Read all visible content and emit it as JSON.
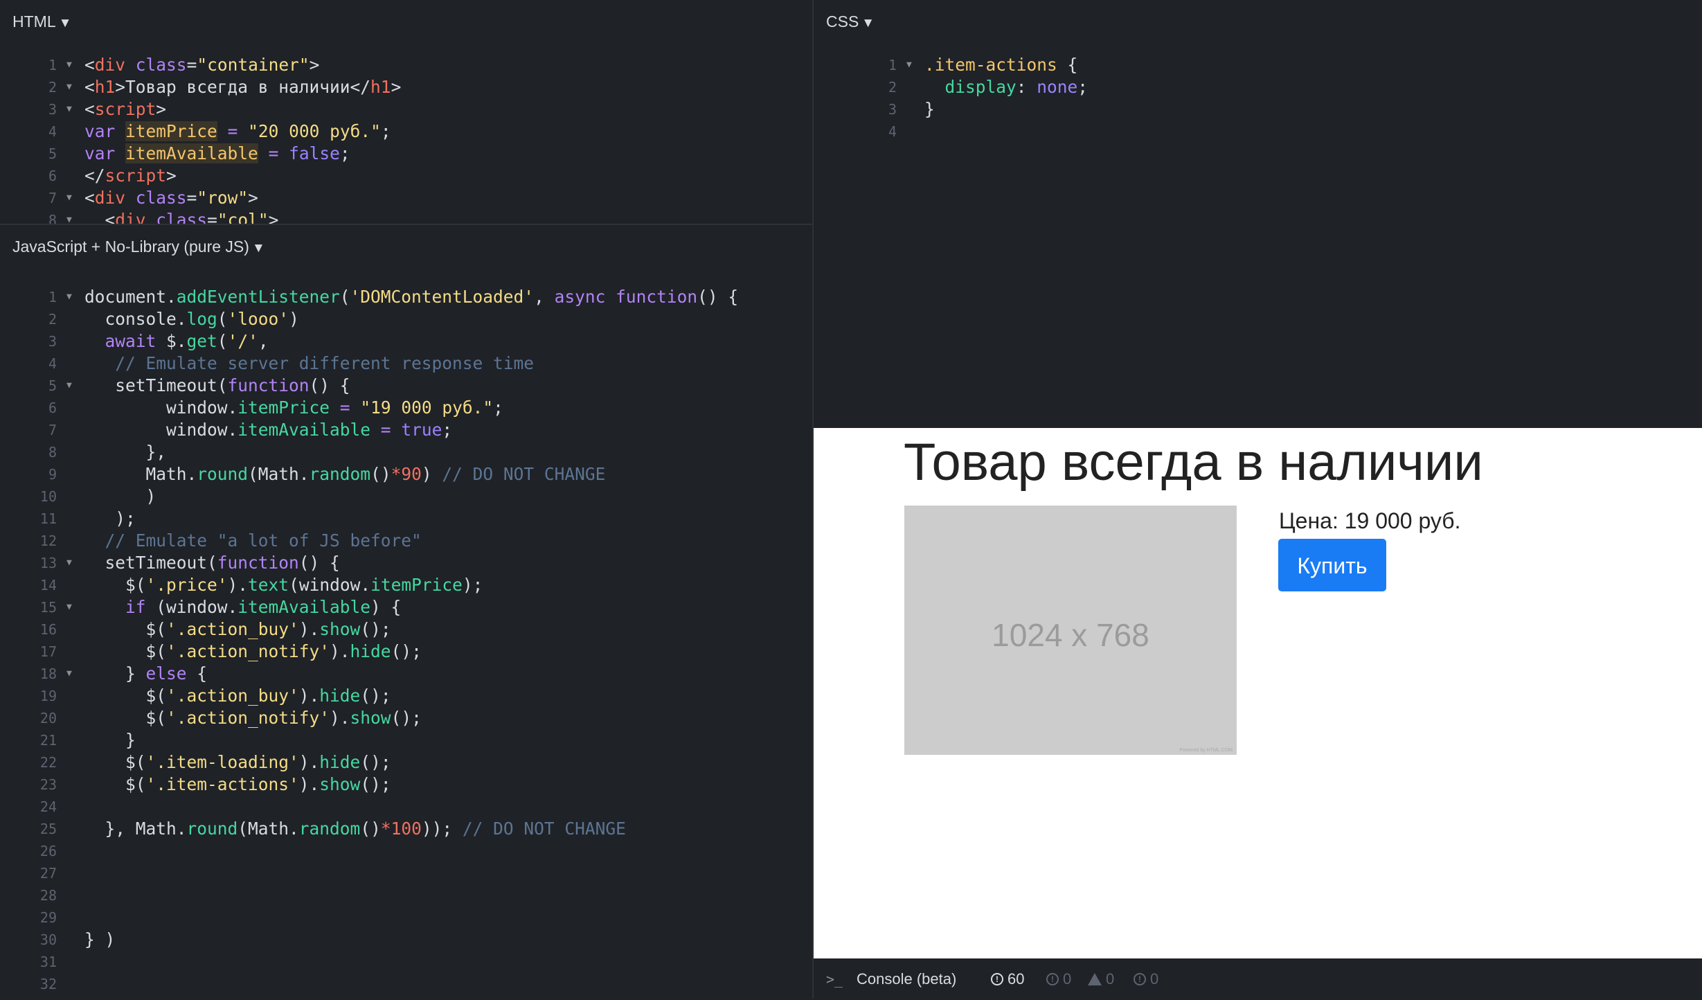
{
  "html_panel": {
    "title": "HTML",
    "lines": [
      {
        "n": "1",
        "f": true,
        "p": [
          [
            "",
            "<"
          ],
          [
            "c-tag",
            "div"
          ],
          [
            "",
            " "
          ],
          [
            "c-kw",
            "class"
          ],
          [
            "",
            "="
          ],
          [
            "c-str",
            "\"container\""
          ],
          [
            "",
            ">"
          ]
        ]
      },
      {
        "n": "2",
        "f": true,
        "p": [
          [
            "",
            "<"
          ],
          [
            "c-tag",
            "h1"
          ],
          [
            "",
            ">Товар всегда в наличии</"
          ],
          [
            "c-tag",
            "h1"
          ],
          [
            "",
            ">"
          ]
        ]
      },
      {
        "n": "3",
        "f": true,
        "p": [
          [
            "",
            "<"
          ],
          [
            "c-tag",
            "script"
          ],
          [
            "",
            ">"
          ]
        ]
      },
      {
        "n": "4",
        "f": false,
        "p": [
          [
            "c-kw",
            "var"
          ],
          [
            "",
            " "
          ],
          [
            "c-var hl",
            "itemPrice"
          ],
          [
            "",
            " "
          ],
          [
            "c-kw",
            "="
          ],
          [
            "",
            " "
          ],
          [
            "c-str",
            "\"20 000 руб.\""
          ],
          [
            "",
            ";"
          ]
        ]
      },
      {
        "n": "5",
        "f": false,
        "p": [
          [
            "c-kw",
            "var"
          ],
          [
            "",
            " "
          ],
          [
            "c-var hl",
            "itemAvailable"
          ],
          [
            "",
            " "
          ],
          [
            "c-kw",
            "="
          ],
          [
            "",
            " "
          ],
          [
            "c-bool",
            "false"
          ],
          [
            "",
            ";"
          ]
        ]
      },
      {
        "n": "6",
        "f": false,
        "p": [
          [
            "",
            "</"
          ],
          [
            "c-tag",
            "script"
          ],
          [
            "",
            ">"
          ]
        ]
      },
      {
        "n": "7",
        "f": true,
        "p": [
          [
            "",
            "<"
          ],
          [
            "c-tag",
            "div"
          ],
          [
            "",
            " "
          ],
          [
            "c-kw",
            "class"
          ],
          [
            "",
            "="
          ],
          [
            "c-str",
            "\"row\""
          ],
          [
            "",
            ">"
          ]
        ]
      },
      {
        "n": "8",
        "f": true,
        "p": [
          [
            "",
            "  <"
          ],
          [
            "c-tag",
            "div"
          ],
          [
            "",
            " "
          ],
          [
            "c-kw",
            "class"
          ],
          [
            "",
            "="
          ],
          [
            "c-str",
            "\"col\""
          ],
          [
            "",
            ">"
          ]
        ]
      }
    ]
  },
  "js_panel": {
    "title": "JavaScript + No-Library (pure JS)",
    "lines": [
      {
        "n": "1",
        "f": true,
        "p": [
          [
            "",
            "document."
          ],
          [
            "c-fn",
            "addEventListener"
          ],
          [
            "",
            "("
          ],
          [
            "c-str",
            "'DOMContentLoaded'"
          ],
          [
            "",
            ", "
          ],
          [
            "c-kw",
            "async function"
          ],
          [
            "",
            "() {"
          ]
        ]
      },
      {
        "n": "2",
        "f": false,
        "p": [
          [
            "",
            "  console."
          ],
          [
            "c-fn",
            "log"
          ],
          [
            "",
            "("
          ],
          [
            "c-str",
            "'looo'"
          ],
          [
            "",
            ")"
          ]
        ]
      },
      {
        "n": "3",
        "f": false,
        "p": [
          [
            "c-kw",
            "  await "
          ],
          [
            "",
            "$."
          ],
          [
            "c-fn",
            "get"
          ],
          [
            "",
            "("
          ],
          [
            "c-str",
            "'/'"
          ],
          [
            "",
            ","
          ]
        ]
      },
      {
        "n": "4",
        "f": false,
        "p": [
          [
            "c-cm",
            "   // Emulate server different response time"
          ]
        ]
      },
      {
        "n": "5",
        "f": true,
        "p": [
          [
            "",
            "   setTimeout("
          ],
          [
            "c-kw",
            "function"
          ],
          [
            "",
            "() {"
          ]
        ]
      },
      {
        "n": "6",
        "f": false,
        "p": [
          [
            "",
            "        window."
          ],
          [
            "c-fn",
            "itemPrice"
          ],
          [
            "",
            " "
          ],
          [
            "c-kw",
            "="
          ],
          [
            "",
            " "
          ],
          [
            "c-str",
            "\"19 000 руб.\""
          ],
          [
            "",
            ";"
          ]
        ]
      },
      {
        "n": "7",
        "f": false,
        "p": [
          [
            "",
            "        window."
          ],
          [
            "c-fn",
            "itemAvailable"
          ],
          [
            "",
            " "
          ],
          [
            "c-kw",
            "="
          ],
          [
            "",
            " "
          ],
          [
            "c-bool",
            "true"
          ],
          [
            "",
            ";"
          ]
        ]
      },
      {
        "n": "8",
        "f": false,
        "p": [
          [
            "",
            "      },"
          ]
        ]
      },
      {
        "n": "9",
        "f": false,
        "p": [
          [
            "",
            "      Math."
          ],
          [
            "c-fn",
            "round"
          ],
          [
            "",
            "(Math."
          ],
          [
            "c-fn",
            "random"
          ],
          [
            "",
            "()"
          ],
          [
            "c-num",
            "*90"
          ],
          [
            "",
            ") "
          ],
          [
            "c-cm",
            "// DO NOT CHANGE"
          ]
        ]
      },
      {
        "n": "10",
        "f": false,
        "p": [
          [
            "",
            "      )"
          ]
        ]
      },
      {
        "n": "11",
        "f": false,
        "p": [
          [
            "",
            "   );"
          ]
        ]
      },
      {
        "n": "12",
        "f": false,
        "p": [
          [
            "c-cm",
            "  // Emulate \"a lot of JS before\""
          ]
        ]
      },
      {
        "n": "13",
        "f": true,
        "p": [
          [
            "",
            "  setTimeout("
          ],
          [
            "c-kw",
            "function"
          ],
          [
            "",
            "() {"
          ]
        ]
      },
      {
        "n": "14",
        "f": false,
        "p": [
          [
            "",
            "    $("
          ],
          [
            "c-str",
            "'.price'"
          ],
          [
            "",
            ")."
          ],
          [
            "c-fn",
            "text"
          ],
          [
            "",
            "(window."
          ],
          [
            "c-fn",
            "itemPrice"
          ],
          [
            "",
            ");"
          ]
        ]
      },
      {
        "n": "15",
        "f": true,
        "p": [
          [
            "c-kw",
            "    if"
          ],
          [
            "",
            " (window."
          ],
          [
            "c-fn",
            "itemAvailable"
          ],
          [
            "",
            ") {"
          ]
        ]
      },
      {
        "n": "16",
        "f": false,
        "p": [
          [
            "",
            "      $("
          ],
          [
            "c-str",
            "'.action_buy'"
          ],
          [
            "",
            ")."
          ],
          [
            "c-fn",
            "show"
          ],
          [
            "",
            "();"
          ]
        ]
      },
      {
        "n": "17",
        "f": false,
        "p": [
          [
            "",
            "      $("
          ],
          [
            "c-str",
            "'.action_notify'"
          ],
          [
            "",
            ")."
          ],
          [
            "c-fn",
            "hide"
          ],
          [
            "",
            "();"
          ]
        ]
      },
      {
        "n": "18",
        "f": true,
        "p": [
          [
            "",
            "    } "
          ],
          [
            "c-kw",
            "else"
          ],
          [
            "",
            " {"
          ]
        ]
      },
      {
        "n": "19",
        "f": false,
        "p": [
          [
            "",
            "      $("
          ],
          [
            "c-str",
            "'.action_buy'"
          ],
          [
            "",
            ")."
          ],
          [
            "c-fn",
            "hide"
          ],
          [
            "",
            "();"
          ]
        ]
      },
      {
        "n": "20",
        "f": false,
        "p": [
          [
            "",
            "      $("
          ],
          [
            "c-str",
            "'.action_notify'"
          ],
          [
            "",
            ")."
          ],
          [
            "c-fn",
            "show"
          ],
          [
            "",
            "();"
          ]
        ]
      },
      {
        "n": "21",
        "f": false,
        "p": [
          [
            "",
            "    }"
          ]
        ]
      },
      {
        "n": "22",
        "f": false,
        "p": [
          [
            "",
            "    $("
          ],
          [
            "c-str",
            "'.item-loading'"
          ],
          [
            "",
            ")."
          ],
          [
            "c-fn",
            "hide"
          ],
          [
            "",
            "();"
          ]
        ]
      },
      {
        "n": "23",
        "f": false,
        "p": [
          [
            "",
            "    $("
          ],
          [
            "c-str",
            "'.item-actions'"
          ],
          [
            "",
            ")."
          ],
          [
            "c-fn",
            "show"
          ],
          [
            "",
            "();"
          ]
        ]
      },
      {
        "n": "24",
        "f": false,
        "p": []
      },
      {
        "n": "25",
        "f": false,
        "p": [
          [
            "",
            "  }, Math."
          ],
          [
            "c-fn",
            "round"
          ],
          [
            "",
            "(Math."
          ],
          [
            "c-fn",
            "random"
          ],
          [
            "",
            "()"
          ],
          [
            "c-num",
            "*100"
          ],
          [
            "",
            "));"
          ],
          [
            "",
            " "
          ],
          [
            "c-cm",
            "// DO NOT CHANGE"
          ]
        ]
      },
      {
        "n": "26",
        "f": false,
        "p": []
      },
      {
        "n": "27",
        "f": false,
        "p": []
      },
      {
        "n": "28",
        "f": false,
        "p": []
      },
      {
        "n": "29",
        "f": false,
        "p": []
      },
      {
        "n": "30",
        "f": false,
        "p": [
          [
            "",
            "} )"
          ]
        ]
      },
      {
        "n": "31",
        "f": false,
        "p": []
      },
      {
        "n": "32",
        "f": false,
        "p": []
      }
    ]
  },
  "css_panel": {
    "title": "CSS",
    "lines": [
      {
        "n": "1",
        "f": true,
        "p": [
          [
            "c-var",
            ".item-actions"
          ],
          [
            "",
            " {"
          ]
        ]
      },
      {
        "n": "2",
        "f": false,
        "p": [
          [
            "c-fn",
            "  display"
          ],
          [
            "",
            ": "
          ],
          [
            "c-bool",
            "none"
          ],
          [
            "",
            ";"
          ]
        ]
      },
      {
        "n": "3",
        "f": false,
        "p": [
          [
            "",
            "}"
          ]
        ]
      },
      {
        "n": "4",
        "f": false,
        "p": []
      }
    ]
  },
  "preview": {
    "title": "Товар всегда в наличии",
    "image_text": "1024 x 768",
    "image_watermark": "Powered by HTML.COM",
    "price": "Цена: 19 000 руб.",
    "buy_label": "Купить",
    "buy_color": "#1a7cf5"
  },
  "console": {
    "prompt": ">_",
    "label": "Console (beta)",
    "count_info": "60",
    "count_log": "0",
    "count_warn": "0",
    "count_error": "0"
  }
}
